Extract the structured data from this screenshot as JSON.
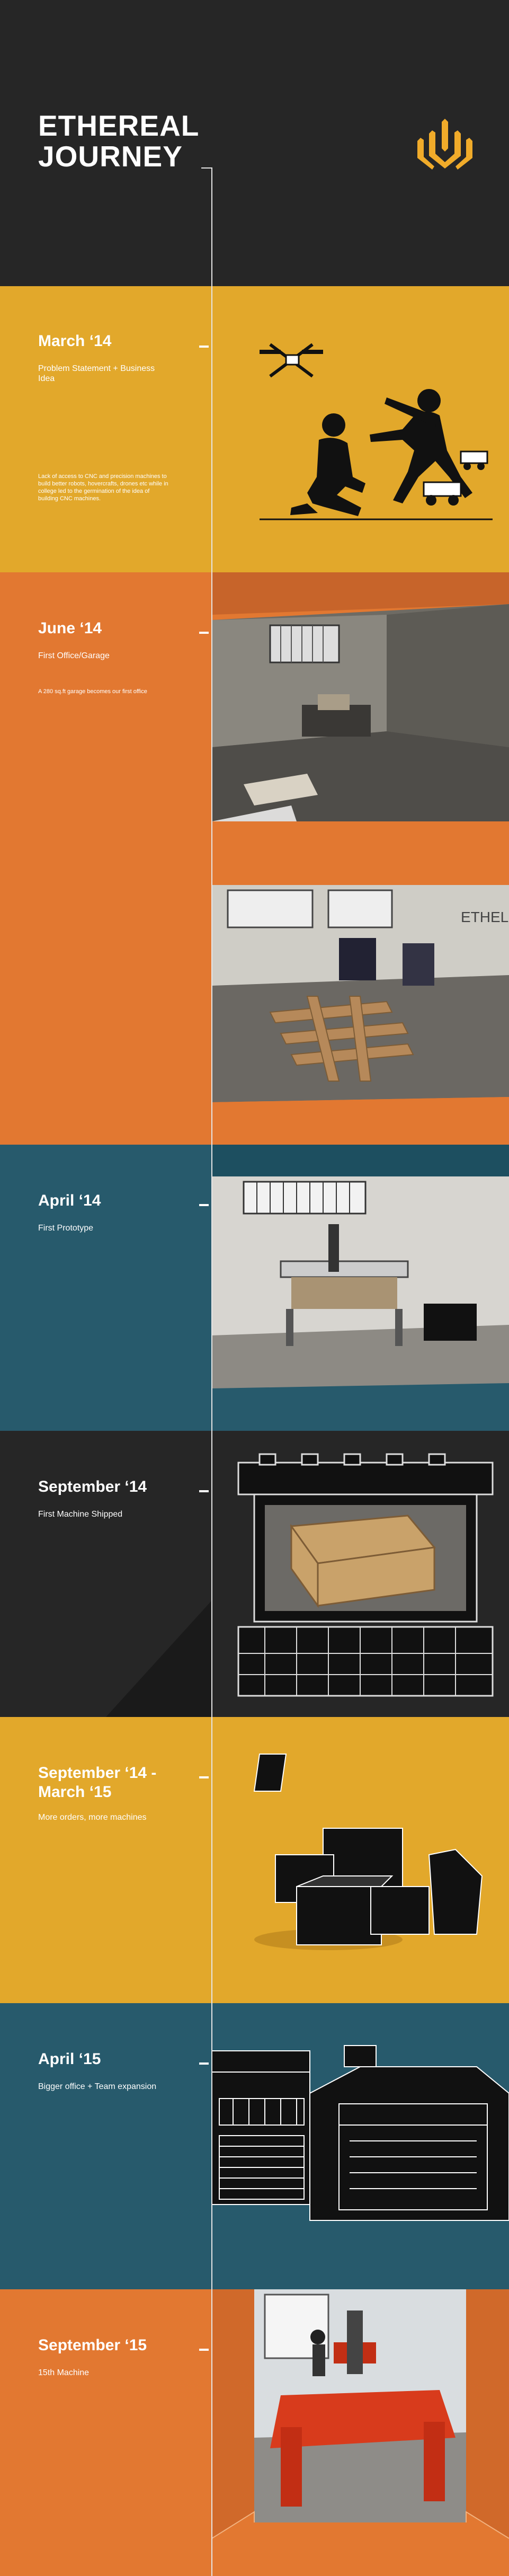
{
  "hero": {
    "title_line1": "ETHEREAL",
    "title_line2": "JOURNEY",
    "logo": "ethereal-machines-logo",
    "accent": "#f0ab2a"
  },
  "colors": {
    "dark": "#262626",
    "yellow": "#e2a82b",
    "orange": "#e27831",
    "teal": "#275a6c"
  },
  "milestones": [
    {
      "date": "March ‘14",
      "caption": "Problem Statement + Business Idea",
      "description": "Lack of access to CNC and precision machines to build better robots, hovercrafts, drones etc while in college led to the germination of the idea of building CNC machines.",
      "icon": "students-building-robots-illustration"
    },
    {
      "date": "June ‘14",
      "caption": "First Office/Garage",
      "description": "A 280 sq.ft garage becomes our first office",
      "icon": "garage-photo"
    },
    {
      "date": "April ‘14",
      "caption": "First Prototype",
      "icon": "prototype-photo"
    },
    {
      "date": "September ‘14",
      "caption": "First Machine Shipped",
      "icon": "shipping-crate-photo"
    },
    {
      "date": "September ‘14 - March ‘15",
      "caption": "More orders, more machines",
      "icon": "boxes-illustration"
    },
    {
      "date": "April ‘15",
      "caption": "Bigger office + Team expansion",
      "icon": "office-buildings-illustration"
    },
    {
      "date": "September ‘15",
      "caption": "15th  Machine",
      "icon": "fifteenth-machine-photo"
    }
  ]
}
